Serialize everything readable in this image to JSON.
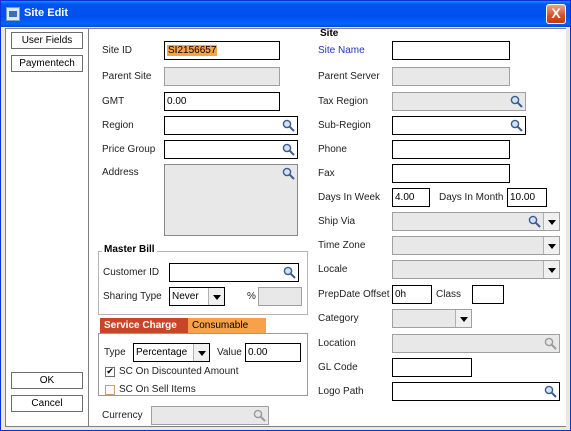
{
  "window": {
    "title": "Site  Edit",
    "close_label": "X"
  },
  "left_buttons": {
    "user_fields": "User Fields",
    "paymentech": "Paymentech",
    "ok": "OK",
    "cancel": "Cancel"
  },
  "section_title": "Site",
  "left_form": {
    "site_id_label": "Site ID",
    "site_id_value": "SI2156657",
    "parent_site_label": "Parent Site",
    "parent_site_value": "",
    "gmt_label": "GMT",
    "gmt_value": "0.00",
    "region_label": "Region",
    "region_value": "",
    "price_group_label": "Price Group",
    "price_group_value": "",
    "address_label": "Address",
    "address_value": ""
  },
  "master_bill": {
    "title": "Master Bill",
    "customer_id_label": "Customer ID",
    "customer_id_value": "",
    "sharing_type_label": "Sharing Type",
    "sharing_type_value": "Never",
    "percent_label": "%",
    "percent_value": ""
  },
  "charge_tabs": {
    "service_charge": "Service Charge",
    "consumable": "Consumable"
  },
  "service_charge": {
    "type_label": "Type",
    "type_value": "Percentage",
    "value_label": "Value",
    "value_value": "0.00",
    "sc_discounted_label": "SC On Discounted Amount",
    "sc_discounted_checked": true,
    "sc_sell_label": "SC On Sell Items",
    "sc_sell_checked": false
  },
  "currency": {
    "label": "Currency",
    "value": ""
  },
  "right_form": {
    "site_name_label": "Site Name",
    "site_name_value": "",
    "parent_server_label": "Parent Server",
    "parent_server_value": "",
    "tax_region_label": "Tax Region",
    "tax_region_value": "",
    "sub_region_label": "Sub-Region",
    "sub_region_value": "",
    "phone_label": "Phone",
    "phone_value": "",
    "fax_label": "Fax",
    "fax_value": "",
    "days_in_week_label": "Days In Week",
    "days_in_week_value": "4.00",
    "days_in_month_label": "Days In Month",
    "days_in_month_value": "10.00",
    "ship_via_label": "Ship Via",
    "ship_via_value": "",
    "time_zone_label": "Time Zone",
    "time_zone_value": "",
    "locale_label": "Locale",
    "locale_value": "",
    "prepdate_offset_label": "PrepDate Offset",
    "prepdate_offset_value": "0h",
    "class_label": "Class",
    "class_value": "",
    "category_label": "Category",
    "category_value": "",
    "location_label": "Location",
    "location_value": "",
    "gl_code_label": "GL Code",
    "gl_code_value": "",
    "logo_path_label": "Logo Path",
    "logo_path_value": ""
  },
  "colors": {
    "title_bar": "#0053EE",
    "highlight": "#F7A24A",
    "tab_active": "#C8452A",
    "tab_inactive": "#F7A24A",
    "label_blue": "#2233CC"
  },
  "icons": {
    "lookup": "magnifier-icon",
    "dropdown": "chevron-down-icon",
    "app": "app-window-icon",
    "close": "close-icon"
  }
}
